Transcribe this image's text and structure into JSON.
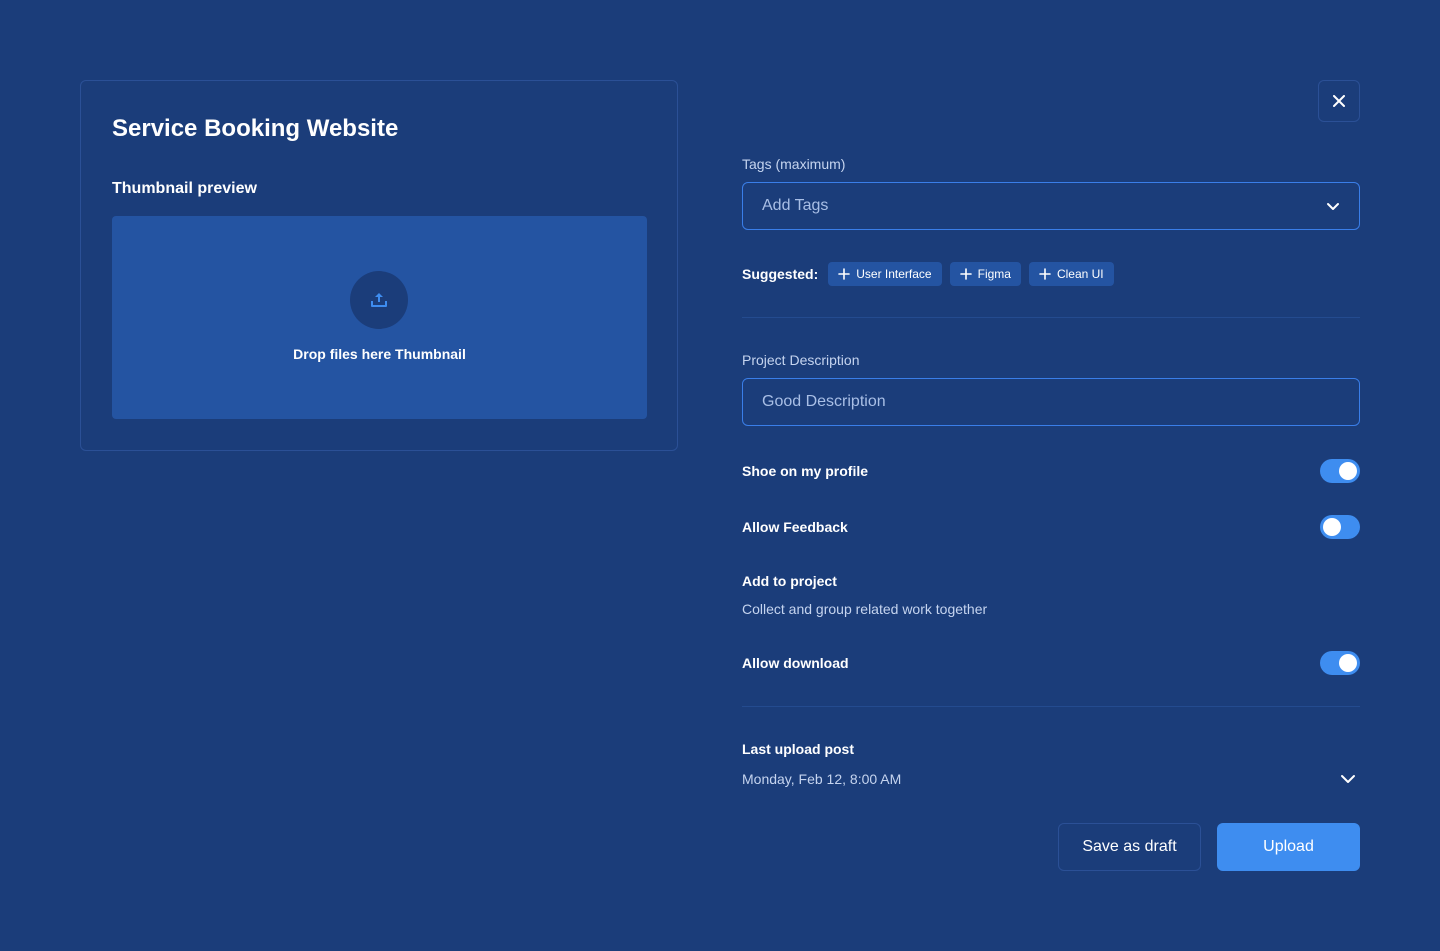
{
  "project": {
    "title": "Service Booking Website",
    "thumbnail_label": "Thumbnail preview",
    "dropzone_text": "Drop files here Thumbnail",
    "upload_icon": "upload-icon"
  },
  "close_icon": "close-icon",
  "tags": {
    "label": "Tags (maximum)",
    "placeholder": "Add Tags",
    "suggested_label": "Suggested:",
    "suggested": [
      "User Interface",
      "Figma",
      "Clean UI"
    ]
  },
  "description": {
    "label": "Project Description",
    "placeholder": "Good Description"
  },
  "settings": {
    "show_on_profile": {
      "label": "Shoe on my profile",
      "on": true
    },
    "allow_feedback": {
      "label": "Allow Feedback",
      "on": false
    },
    "add_to_project": {
      "label": "Add to project",
      "subtitle": "Collect and group related work together"
    },
    "allow_download": {
      "label": "Allow download",
      "on": true
    }
  },
  "last_upload": {
    "label": "Last upload post",
    "value": "Monday, Feb 12, 8:00 AM"
  },
  "actions": {
    "draft_label": "Save as draft",
    "upload_label": "Upload"
  },
  "colors": {
    "background": "#1b3d7a",
    "accent": "#3e8df0",
    "dropzone": "#2454a2",
    "border": "#2b5096"
  }
}
